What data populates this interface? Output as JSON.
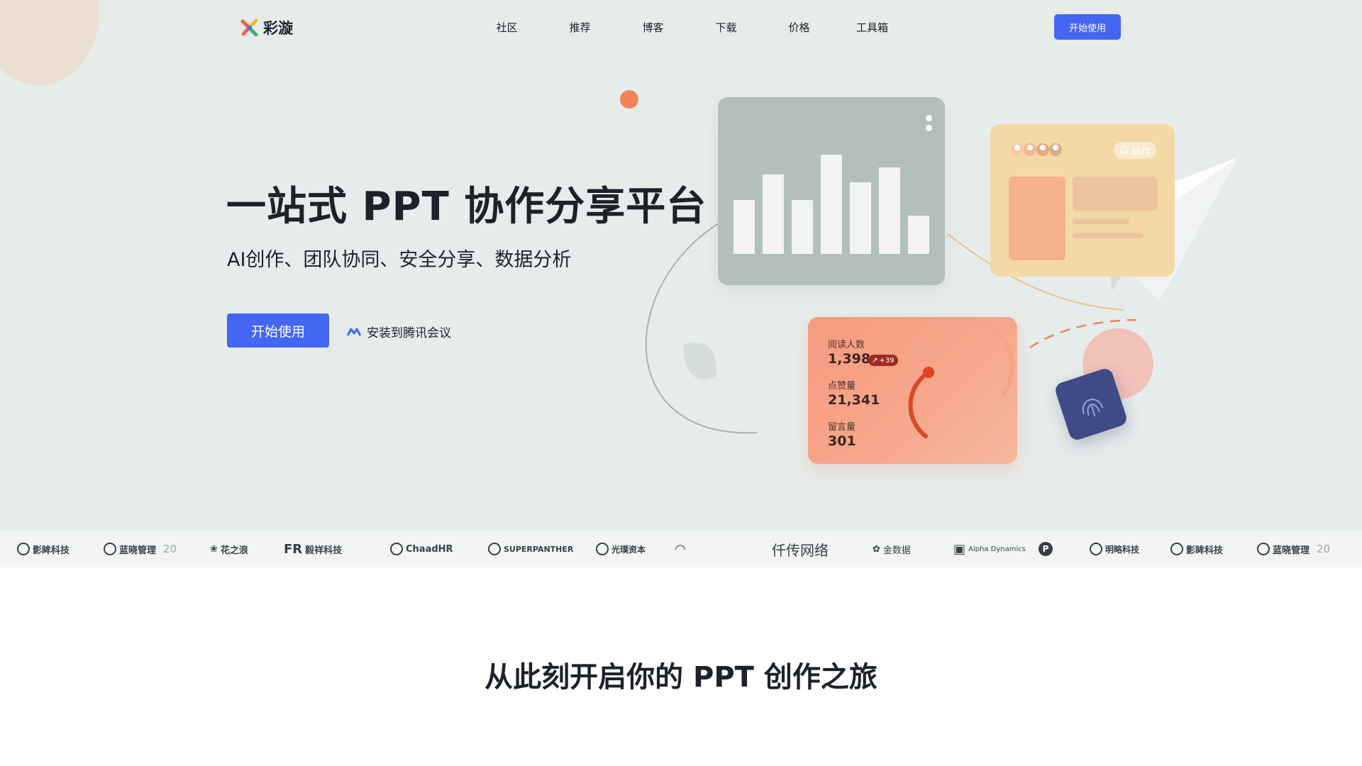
{
  "nav": {
    "logo_text": "彩漩",
    "links": [
      "社区",
      "推荐",
      "博客",
      "下载",
      "价格",
      "工具箱"
    ],
    "cta_label": "开始使用"
  },
  "hero": {
    "title": "一站式 PPT 协作分享平台",
    "subtitle": "AI创作、团队协同、安全分享、数据分析",
    "cta_label": "开始使用",
    "install_label": "安装到腾讯会议"
  },
  "illustration": {
    "bar_values": [
      0.42,
      0.62,
      0.42,
      0.78,
      0.56,
      0.68,
      0.3
    ],
    "collab_chip": "协作",
    "stats": {
      "reads_label": "阅读人数",
      "reads_value": "1,398",
      "reads_badge": "+39",
      "likes_label": "点赞量",
      "likes_value": "21,341",
      "comments_label": "留言量",
      "comments_value": "301"
    }
  },
  "partners": [
    {
      "name": "影眸科技",
      "icon": "ring-icon"
    },
    {
      "name": "蓝晓管理",
      "suffix": "20",
      "icon": "seal-icon"
    },
    {
      "name": "花之浪",
      "icon": "flame-icon"
    },
    {
      "name": "毅祥科技",
      "icon": "fr-icon"
    },
    {
      "name": "ChaadHR",
      "icon": "c-icon"
    },
    {
      "name": "SUPERPANTHER",
      "icon": "panther-icon"
    },
    {
      "name": "光璞资本",
      "icon": "g-icon"
    },
    {
      "name": "",
      "icon": "arc-icon"
    },
    {
      "name": "仟传网络",
      "icon": ""
    },
    {
      "name": "金数据",
      "icon": "sprout-icon"
    },
    {
      "name": "Alpha Dynamics",
      "icon": "cube-icon"
    },
    {
      "name": "",
      "icon": "p-icon"
    },
    {
      "name": "明略科技",
      "icon": "ball-icon"
    },
    {
      "name": "影眸科技",
      "icon": "ring-icon"
    },
    {
      "name": "蓝晓管理",
      "suffix": "20",
      "icon": "seal-icon"
    }
  ],
  "section2": {
    "title": "从此刻开启你的 PPT 创作之旅"
  },
  "colors": {
    "primary": "#4466f2",
    "hero_bg": "#e6eceb",
    "orange_card": "#f59a80",
    "yellow_card": "#f4d9a7",
    "grey_card": "#b3bfba"
  }
}
